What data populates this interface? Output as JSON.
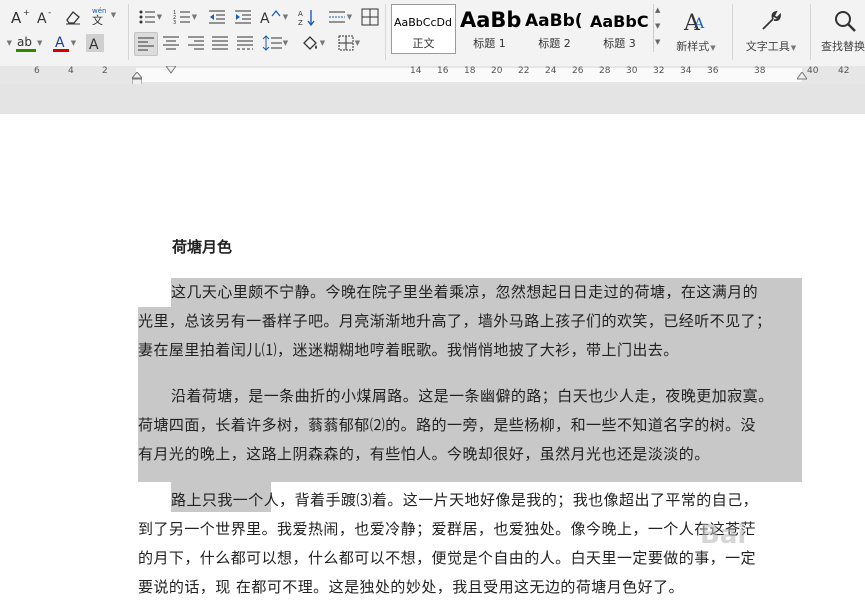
{
  "toolbar": {
    "row1_icons": [
      "increase-font-icon",
      "decrease-font-icon",
      "clear-format-icon",
      "phonetic-guide-icon",
      "bullet-list-icon",
      "numbered-list-icon",
      "decrease-indent-icon",
      "increase-indent-icon",
      "change-case-icon",
      "sort-icon",
      "chinese-layout-icon",
      "show-marks-icon"
    ],
    "row2_icons": [
      "highlight-icon",
      "font-color-icon",
      "char-shading-icon",
      "align-left-icon",
      "align-center-icon",
      "align-right-icon",
      "justify-icon",
      "distributed-icon",
      "line-spacing-icon",
      "fill-icon",
      "border-icon"
    ],
    "styles": [
      {
        "preview": "AaBbCcDd",
        "name": "正文"
      },
      {
        "preview": "AaBb",
        "name": "标题 1"
      },
      {
        "preview": "AaBb(",
        "name": "标题 2"
      },
      {
        "preview": "AaBbC",
        "name": "标题 3"
      }
    ],
    "new_style_label": "新样式",
    "text_tools_label": "文字工具",
    "find_replace_label": "查找替换",
    "colors": {
      "highlight": "#2e8b00",
      "font": "#d40000"
    }
  },
  "ruler": {
    "left_labels": [
      "6",
      "4",
      "2"
    ],
    "right_labels": [
      "14",
      "16",
      "18",
      "20",
      "22",
      "24",
      "26",
      "28",
      "30",
      "32",
      "34",
      "36",
      "38",
      "40",
      "42"
    ]
  },
  "document": {
    "title": "荷塘月色",
    "lines": [
      "这几天心里颇不宁静。今晚在院子里坐着乘凉，忽然想起日日走过的荷塘，在这满月的",
      "光里，总该另有一番样子吧。月亮渐渐地升高了，墙外马路上孩子们的欢笑，已经听不见了；",
      "妻在屋里拍着闰儿⑴，迷迷糊糊地哼着眠歌。我悄悄地披了大衫，带上门出去。",
      "沿着荷塘，是一条曲折的小煤屑路。这是一条幽僻的路；白天也少人走，夜晚更加寂寞。",
      "荷塘四面，长着许多树，蓊蓊郁郁⑵的。路的一旁，是些杨柳，和一些不知道名字的树。没",
      "有月光的晚上，这路上阴森森的，有些怕人。今晚却很好，虽然月光也还是淡淡的。",
      "路上只我一个人，背着手踱⑶着。这一片天地好像是我的；我也像超出了平常的自己，",
      "到了另一个世界里。我爱热闹，也爱冷静；爱群居，也爱独处。像今晚上，一个人在这苍茫",
      "的月下，什么都可以想，什么都可以不想，便觉是个自由的人。白天里一定要做的事，一定",
      "要说的话，现 在都可不理。这是独处的妙处，我且受用这无边的荷塘月色好了。"
    ]
  },
  "watermark": "Bai"
}
